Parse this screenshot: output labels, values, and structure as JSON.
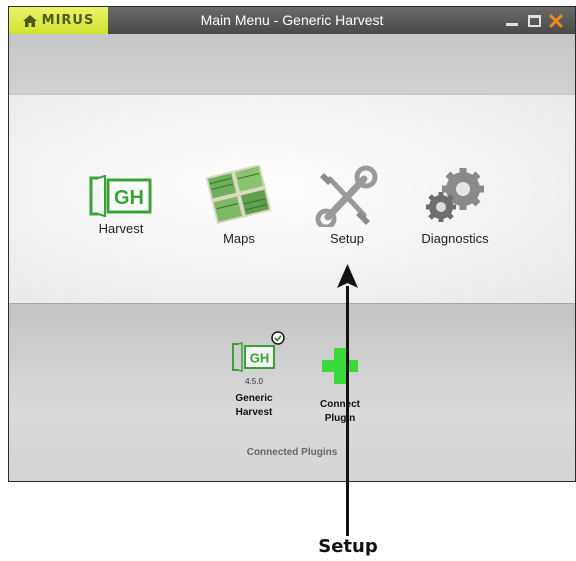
{
  "window": {
    "brand": "MIRUS",
    "title": "Main Menu - Generic Harvest"
  },
  "menu": {
    "items": [
      {
        "label": "Harvest",
        "icon": "generic-harvest-logo-icon"
      },
      {
        "label": "Maps",
        "icon": "maps-icon"
      },
      {
        "label": "Setup",
        "icon": "wrench-screwdriver-icon"
      },
      {
        "label": "Diagnostics",
        "icon": "gears-icon"
      }
    ]
  },
  "plugins": {
    "items": [
      {
        "name_line1": "Generic",
        "name_line2": "Harvest",
        "version": "4.5.0",
        "status": "connected"
      },
      {
        "name_line1": "Connect",
        "name_line2": "Plugin"
      }
    ],
    "section_label": "Connected Plugins"
  },
  "callout": {
    "text": "Setup"
  },
  "colors": {
    "brand_bg": "#dbe843",
    "titlebar_bg": "#555555",
    "accent_green": "#3aa335",
    "close_orange": "#f08a1c",
    "plus_green": "#3ad93a"
  },
  "logo_text": "GH"
}
